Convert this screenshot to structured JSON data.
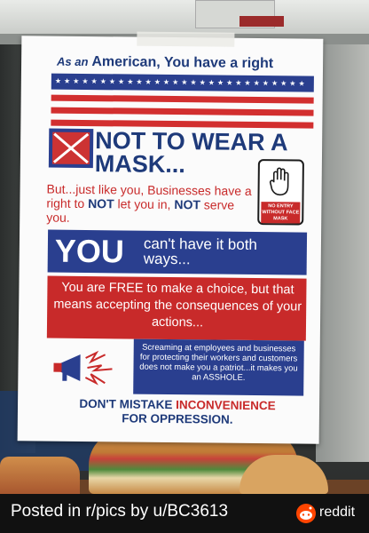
{
  "poster": {
    "line1_prefix": "As an",
    "line1_main": "American, You have a right",
    "stars": "★★★★★★★★★★★★★★★★★★★★★★★★★★★★",
    "headline": "NOT TO WEAR A MASK...",
    "body_part1": "But...just like you, Businesses have a right to ",
    "body_not1": "NOT",
    "body_part2": " let you in, ",
    "body_not2": "NOT",
    "body_part3": " serve you.",
    "entry_sign": "NO ENTRY WITHOUT FACE MASK",
    "you_big": "YOU",
    "you_small": "can't have it both ways...",
    "free_text": "You are FREE to make a choice, but that means accepting the consequences of your actions...",
    "scream_text": "Screaming at employees and businesses for protecting their workers and customers does not make you a patriot...it makes you an ASSHOLE.",
    "footer_part1": "DON'T MISTAKE ",
    "footer_red": "INCONVENIENCE",
    "footer_part2": "FOR OPPRESSION."
  },
  "caption": {
    "posted": "Posted in r/pics by u/BC3613",
    "brand": "reddit"
  },
  "colors": {
    "navy": "#2a3f8f",
    "red": "#c82a2a",
    "reddit": "#ff4500"
  }
}
